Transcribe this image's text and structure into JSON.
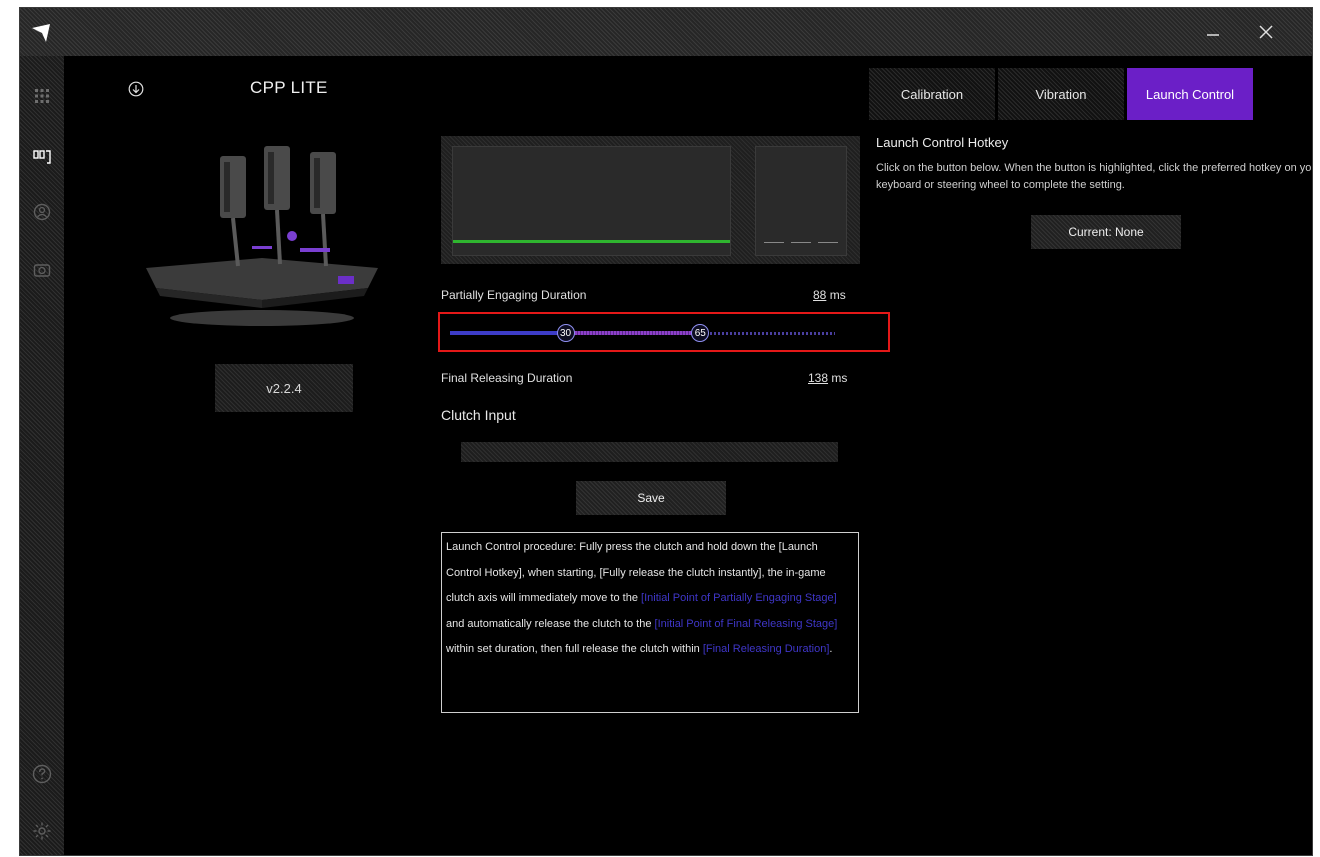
{
  "device": {
    "name": "CPP LITE",
    "version": "v2.2.4"
  },
  "tabs": [
    {
      "label": "Calibration",
      "active": false
    },
    {
      "label": "Vibration",
      "active": false
    },
    {
      "label": "Launch Control",
      "active": true
    }
  ],
  "partially_engaging": {
    "label": "Partially Engaging Duration",
    "value": "88",
    "unit": "ms"
  },
  "slider": {
    "min_value": "30",
    "max_value": "65",
    "range_min": 0,
    "range_max": 100
  },
  "final_releasing": {
    "label": "Final Releasing Duration",
    "value": "138",
    "unit": "ms"
  },
  "clutch_input": {
    "label": "Clutch Input"
  },
  "save_label": "Save",
  "info": {
    "p1": "Launch Control procedure: Fully press the clutch and hold down the [Launch Control Hotkey], when starting, [Fully release the clutch instantly], the in-game clutch axis will immediately move to the ",
    "hl1": "[Initial Point of Partially Engaging Stage]",
    "p2": " and automatically release the clutch to the ",
    "hl2": "[Initial Point of Final Releasing Stage]",
    "p3": " within set duration, then full release the clutch within ",
    "hl3": "[Final Releasing Duration]",
    "p4": "."
  },
  "hotkey": {
    "title": "Launch Control Hotkey",
    "description": "Click on the button below. When the button is highlighted, click the preferred hotkey on your keyboard or steering wheel to complete the setting.",
    "current_label": "Current: None"
  },
  "colors": {
    "accent_purple": "#6b1fc7",
    "graph_green": "#2fb52f",
    "highlight_box": "#e41818"
  },
  "icons": {
    "app_logo": "logo-icon",
    "minimize": "minimize-icon",
    "close": "close-icon",
    "sidebar": [
      "grid-icon",
      "pedals-icon",
      "profile-icon",
      "camera-icon",
      "help-icon",
      "settings-icon"
    ],
    "download": "download-icon"
  }
}
